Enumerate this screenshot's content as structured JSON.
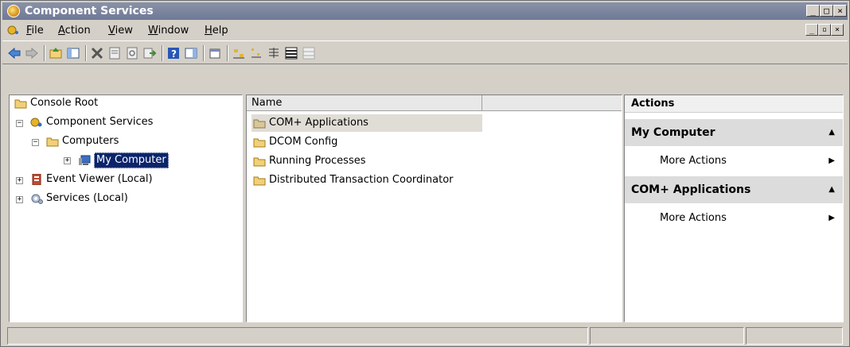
{
  "window": {
    "title": "Component Services"
  },
  "menubar": {
    "items": [
      {
        "label": "File",
        "u": "F",
        "rest": "ile"
      },
      {
        "label": "Action",
        "u": "A",
        "rest": "ction"
      },
      {
        "label": "View",
        "u": "V",
        "rest": "iew"
      },
      {
        "label": "Window",
        "u": "W",
        "rest": "indow"
      },
      {
        "label": "Help",
        "u": "H",
        "rest": "elp"
      }
    ]
  },
  "toolbar": {
    "icons": [
      "back-icon",
      "forward-icon",
      "up-folder-icon",
      "show-hide-tree-icon",
      "delete-icon",
      "properties-icon",
      "refresh-icon",
      "export-list-icon",
      "help-icon",
      "show-hide-action-pane-icon",
      "new-window-icon",
      "large-icons-icon",
      "small-icons-icon",
      "list-view-icon",
      "detail-view-icon",
      "configure-view-icon"
    ]
  },
  "tree": {
    "items": [
      {
        "label": "Console Root"
      },
      {
        "label": "Component Services"
      },
      {
        "label": "Computers"
      },
      {
        "label": "My Computer"
      },
      {
        "label": "Event Viewer (Local)"
      },
      {
        "label": "Services (Local)"
      }
    ]
  },
  "list": {
    "columns": [
      "Name",
      ""
    ],
    "rows": [
      {
        "name": "COM+ Applications"
      },
      {
        "name": "DCOM Config"
      },
      {
        "name": "Running Processes"
      },
      {
        "name": "Distributed Transaction Coordinator"
      }
    ]
  },
  "actions": {
    "header": "Actions",
    "sections": [
      {
        "title": "My Computer",
        "item": "More Actions"
      },
      {
        "title": "COM+ Applications",
        "item": "More Actions"
      }
    ]
  },
  "colors": {
    "titlebar": "#7a839f",
    "selection": "#0a246a",
    "chrome": "#d4d0c8"
  }
}
